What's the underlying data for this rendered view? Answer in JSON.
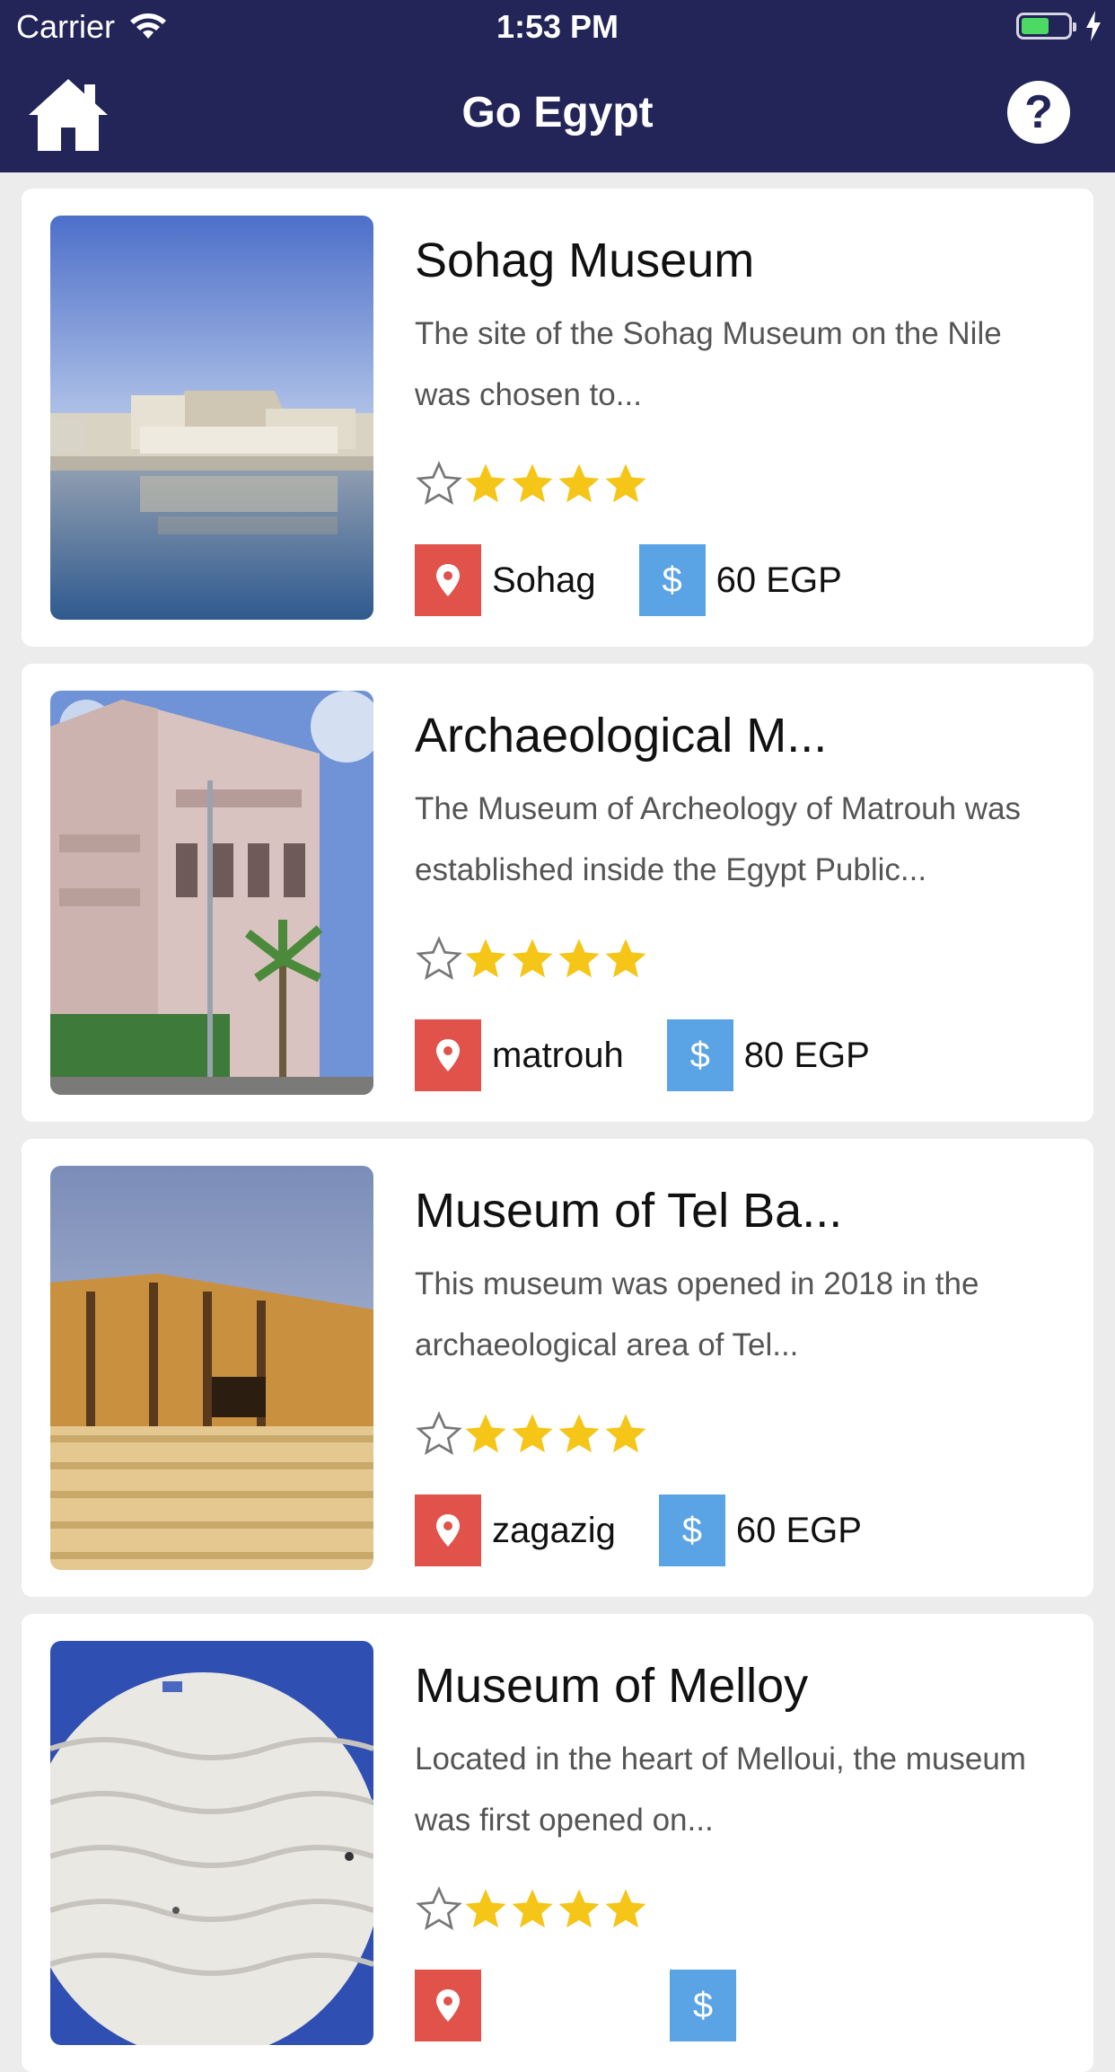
{
  "status_bar": {
    "carrier": "Carrier",
    "time": "1:53 PM",
    "battery_color": "#4cd964"
  },
  "navbar": {
    "title": "Go Egypt",
    "home_icon": "home-icon",
    "help_label": "?",
    "background": "#232457"
  },
  "colors": {
    "star": "#f5c518",
    "location_badge": "#e0524a",
    "price_badge": "#5aa3e4"
  },
  "museums": [
    {
      "title": "Sohag Museum",
      "description": "The site of the Sohag Museum on the Nile was chosen to...",
      "rating": 4,
      "location": "Sohag",
      "currency_symbol": "$",
      "price": "60 EGP"
    },
    {
      "title": "Archaeological M...",
      "description": "The Museum of Archeology of Matrouh was established inside the Egypt Public...",
      "rating": 4,
      "location": "matrouh",
      "currency_symbol": "$",
      "price": "80 EGP"
    },
    {
      "title": "Museum of Tel Ba...",
      "description": "This museum was opened in 2018 in the archaeological area of Tel...",
      "rating": 4,
      "location": "zagazig",
      "currency_symbol": "$",
      "price": "60 EGP"
    },
    {
      "title": "Museum of Melloy",
      "description": "Located in the heart of Melloui, the museum was first opened on...",
      "rating": 4,
      "location": "",
      "currency_symbol": "$",
      "price": ""
    }
  ]
}
